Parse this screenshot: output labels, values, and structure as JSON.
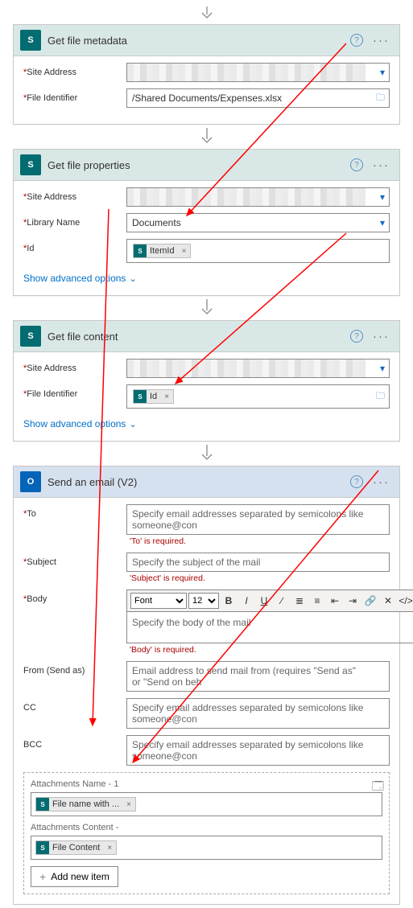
{
  "cards": {
    "metadata": {
      "title": "Get file metadata",
      "fields": {
        "site_label": "Site Address",
        "file_id_label": "File Identifier",
        "file_id_value": "/Shared Documents/Expenses.xlsx"
      }
    },
    "properties": {
      "title": "Get file properties",
      "fields": {
        "site_label": "Site Address",
        "library_label": "Library Name",
        "library_value": "Documents",
        "id_label": "Id",
        "id_token": "ItemId"
      },
      "advanced": "Show advanced options"
    },
    "content": {
      "title": "Get file content",
      "fields": {
        "site_label": "Site Address",
        "file_id_label": "File Identifier",
        "file_id_token": "Id"
      },
      "advanced": "Show advanced options"
    },
    "email": {
      "title": "Send an email (V2)",
      "fields": {
        "to_label": "To",
        "to_placeholder": "Specify email addresses separated by semicolons like someone@con",
        "to_error": "'To' is required.",
        "subject_label": "Subject",
        "subject_placeholder": "Specify the subject of the mail",
        "subject_error": "'Subject' is required.",
        "body_label": "Body",
        "body_font": "Font",
        "body_size": "12",
        "body_placeholder": "Specify the body of the mail",
        "body_error": "'Body' is required.",
        "from_label": "From (Send as)",
        "from_placeholder": "Email address to send mail from (requires \"Send as\" or \"Send on beh",
        "cc_label": "CC",
        "cc_placeholder": "Specify email addresses separated by semicolons like someone@con",
        "bcc_label": "BCC",
        "bcc_placeholder": "Specify email addresses separated by semicolons like someone@con"
      },
      "attachments": {
        "name_label": "Attachments Name - 1",
        "name_token": "File name with ...",
        "content_label": "Attachments Content -",
        "content_token": "File Content",
        "add_item": "Add new item"
      }
    }
  }
}
